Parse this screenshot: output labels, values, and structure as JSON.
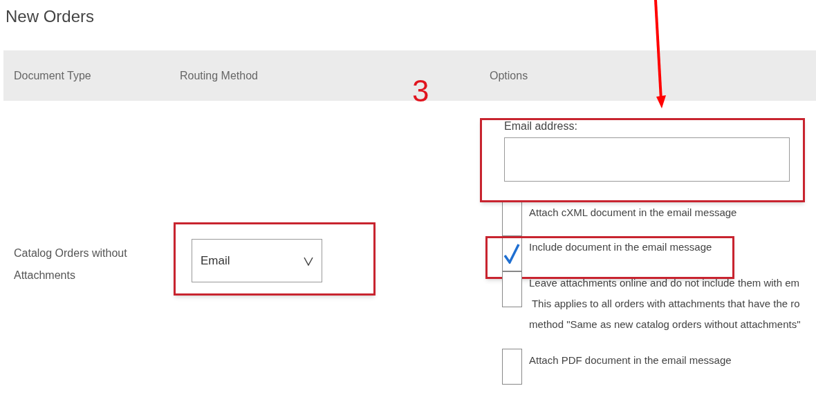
{
  "title": "New Orders",
  "columns": [
    "Document Type",
    "Routing Method",
    "Options"
  ],
  "row": {
    "document_type": "Catalog Orders without Attachments",
    "routing_method": "Email",
    "email_label": "Email address:",
    "options": [
      {
        "lines": [
          "Attach cXML document in the email message"
        ],
        "checked": false,
        "highlighted": false
      },
      {
        "lines": [
          "Include document in the email message"
        ],
        "checked": true,
        "highlighted": true
      },
      {
        "lines": [
          "Leave attachments online and do not include them with em",
          " This applies to all orders with attachments that have the ro",
          "method \"Same as new catalog orders without attachments\""
        ],
        "checked": false,
        "highlighted": false
      },
      {
        "lines": [
          "Attach PDF document in the email message"
        ],
        "checked": false,
        "highlighted": false
      }
    ]
  },
  "annotation": {
    "step": "3"
  }
}
